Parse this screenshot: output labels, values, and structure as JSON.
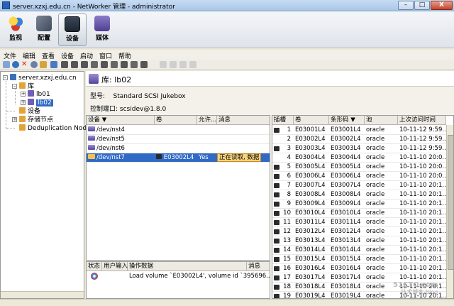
{
  "window": {
    "title": "server.xzxj.edu.cn - NetWorker 管理 - administrator",
    "minimize": "–",
    "maximize": "□",
    "close": "X"
  },
  "big_toolbar": [
    {
      "label": "监视",
      "icon": "monitor-icon"
    },
    {
      "label": "配置",
      "icon": "config-icon"
    },
    {
      "label": "设备",
      "icon": "devices-icon"
    },
    {
      "label": "媒体",
      "icon": "media-icon"
    }
  ],
  "menu": [
    "文件",
    "编辑",
    "查看",
    "设备",
    "启动",
    "窗口",
    "帮助"
  ],
  "tree": {
    "server": "server.xzxj.edu.cn",
    "libraries": "库",
    "lib01": "lb01",
    "lib02": "lb02",
    "devices": "设备",
    "storage_nodes": "存储节点",
    "dedup": "Deduplication Nodes"
  },
  "panel": {
    "title": "库: lb02",
    "model_label": "型号:",
    "model_value": "Standard SCSI Jukebox",
    "control_label": "控制端口:",
    "control_value": "scsidev@1.8.0"
  },
  "device_table": {
    "headers": [
      "设备 ▼",
      "卷",
      "允许...",
      "消息"
    ],
    "rows": [
      {
        "device": "/dev/nst4",
        "volume": "",
        "allow": "",
        "message": ""
      },
      {
        "device": "/dev/nst5",
        "volume": "",
        "allow": "",
        "message": ""
      },
      {
        "device": "/dev/nst6",
        "volume": "",
        "allow": "",
        "message": ""
      },
      {
        "device": "/dev/nst7",
        "volume": "E03002L4",
        "allow": "Yes",
        "message": "正在读取, 数据"
      }
    ]
  },
  "log_table": {
    "headers": [
      "状态",
      "用户输入",
      "操作数据",
      "消息"
    ],
    "rows": [
      {
        "data": "Load volume `E03002L4', volume id `395696..."
      }
    ]
  },
  "slot_table": {
    "headers": [
      "插槽",
      "卷",
      "条形码 ▼",
      "池",
      "上次访问时间"
    ],
    "rows": [
      {
        "slot": "1",
        "volume": "E03001L4",
        "barcode": "E03001L4",
        "pool": "oracle",
        "time": "10-11-12 9:59..."
      },
      {
        "slot": "2",
        "volume": "E03002L4",
        "barcode": "E03002L4",
        "pool": "oracle",
        "time": "10-11-12 9:59..."
      },
      {
        "slot": "3",
        "volume": "E03003L4",
        "barcode": "E03003L4",
        "pool": "oracle",
        "time": "10-11-12 9:59..."
      },
      {
        "slot": "4",
        "volume": "E03004L4",
        "barcode": "E03004L4",
        "pool": "oracle",
        "time": "10-11-10 20:0..."
      },
      {
        "slot": "5",
        "volume": "E03005L4",
        "barcode": "E03005L4",
        "pool": "oracle",
        "time": "10-11-10 20:0..."
      },
      {
        "slot": "6",
        "volume": "E03006L4",
        "barcode": "E03006L4",
        "pool": "oracle",
        "time": "10-11-10 20:0..."
      },
      {
        "slot": "7",
        "volume": "E03007L4",
        "barcode": "E03007L4",
        "pool": "oracle",
        "time": "10-11-10 20:1..."
      },
      {
        "slot": "8",
        "volume": "E03008L4",
        "barcode": "E03008L4",
        "pool": "oracle",
        "time": "10-11-10 20:1..."
      },
      {
        "slot": "9",
        "volume": "E03009L4",
        "barcode": "E03009L4",
        "pool": "oracle",
        "time": "10-11-10 20:1..."
      },
      {
        "slot": "10",
        "volume": "E03010L4",
        "barcode": "E03010L4",
        "pool": "oracle",
        "time": "10-11-10 20:1..."
      },
      {
        "slot": "11",
        "volume": "E03011L4",
        "barcode": "E03011L4",
        "pool": "oracle",
        "time": "10-11-10 20:1..."
      },
      {
        "slot": "12",
        "volume": "E03012L4",
        "barcode": "E03012L4",
        "pool": "oracle",
        "time": "10-11-10 20:1..."
      },
      {
        "slot": "13",
        "volume": "E03013L4",
        "barcode": "E03013L4",
        "pool": "oracle",
        "time": "10-11-10 20:1..."
      },
      {
        "slot": "14",
        "volume": "E03014L4",
        "barcode": "E03014L4",
        "pool": "oracle",
        "time": "10-11-10 20:1..."
      },
      {
        "slot": "15",
        "volume": "E03015L4",
        "barcode": "E03015L4",
        "pool": "oracle",
        "time": "10-11-10 20:1..."
      },
      {
        "slot": "16",
        "volume": "E03016L4",
        "barcode": "E03016L4",
        "pool": "oracle",
        "time": "10-11-10 20:1..."
      },
      {
        "slot": "17",
        "volume": "E03017L4",
        "barcode": "E03017L4",
        "pool": "oracle",
        "time": "10-11-10 20:1..."
      },
      {
        "slot": "18",
        "volume": "E03018L4",
        "barcode": "E03018L4",
        "pool": "oracle",
        "time": "10-11-10 20:1..."
      },
      {
        "slot": "19",
        "volume": "E03019L4",
        "barcode": "E03019L4",
        "pool": "oracle",
        "time": "10-11-10 20:1..."
      }
    ]
  },
  "watermark": {
    "line1": "51CTO.com",
    "line2": "技术博客 Blog"
  }
}
